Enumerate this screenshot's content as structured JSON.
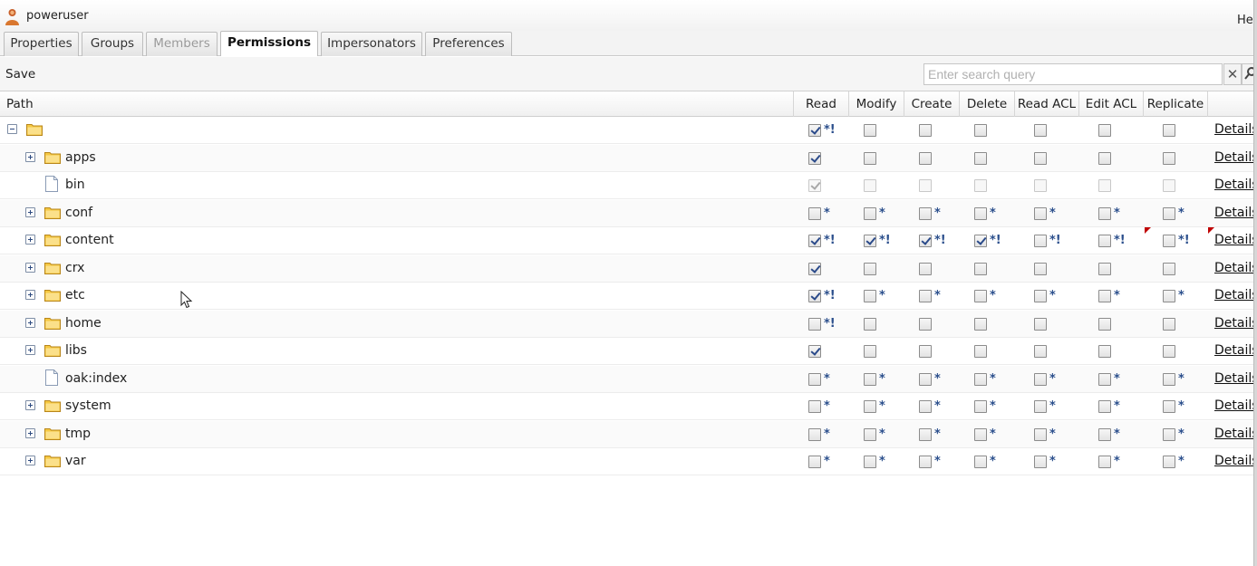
{
  "user": {
    "name": "poweruser",
    "icon": "user-icon"
  },
  "help_label": "Hel",
  "tabs": [
    {
      "label": "Properties",
      "state": "normal"
    },
    {
      "label": "Groups",
      "state": "normal"
    },
    {
      "label": "Members",
      "state": "disabled"
    },
    {
      "label": "Permissions",
      "state": "active"
    },
    {
      "label": "Impersonators",
      "state": "normal"
    },
    {
      "label": "Preferences",
      "state": "normal"
    }
  ],
  "toolbar": {
    "save_label": "Save"
  },
  "search": {
    "placeholder": "Enter search query",
    "clear_icon": "close-icon",
    "go_icon": "search-icon"
  },
  "columns": [
    "Path",
    "Read",
    "Modify",
    "Create",
    "Delete",
    "Read ACL",
    "Edit ACL",
    "Replicate"
  ],
  "details_label": "Details",
  "colors": {
    "check_mark": "#2a4a8a",
    "marker": "#2b4f8c",
    "corner_flag": "#c00000",
    "folder": "#f5c842"
  },
  "rows": [
    {
      "label": "",
      "type": "folder",
      "expander": "minus",
      "indent": 0,
      "cells": [
        {
          "checked": true,
          "mark": "*!"
        },
        {
          "checked": false,
          "mark": ""
        },
        {
          "checked": false,
          "mark": ""
        },
        {
          "checked": false,
          "mark": ""
        },
        {
          "checked": false,
          "mark": ""
        },
        {
          "checked": false,
          "mark": ""
        },
        {
          "checked": false,
          "mark": ""
        }
      ]
    },
    {
      "label": "apps",
      "type": "folder",
      "expander": "plus",
      "indent": 1,
      "cells": [
        {
          "checked": true,
          "mark": ""
        },
        {
          "checked": false,
          "mark": ""
        },
        {
          "checked": false,
          "mark": ""
        },
        {
          "checked": false,
          "mark": ""
        },
        {
          "checked": false,
          "mark": ""
        },
        {
          "checked": false,
          "mark": ""
        },
        {
          "checked": false,
          "mark": ""
        }
      ]
    },
    {
      "label": "bin",
      "type": "file",
      "expander": "none",
      "indent": 1,
      "dim": true,
      "cells": [
        {
          "checked": true,
          "mark": ""
        },
        {
          "checked": false,
          "mark": ""
        },
        {
          "checked": false,
          "mark": ""
        },
        {
          "checked": false,
          "mark": ""
        },
        {
          "checked": false,
          "mark": ""
        },
        {
          "checked": false,
          "mark": ""
        },
        {
          "checked": false,
          "mark": ""
        }
      ]
    },
    {
      "label": "conf",
      "type": "folder",
      "expander": "plus",
      "indent": 1,
      "cells": [
        {
          "checked": false,
          "mark": "*"
        },
        {
          "checked": false,
          "mark": "*"
        },
        {
          "checked": false,
          "mark": "*"
        },
        {
          "checked": false,
          "mark": "*"
        },
        {
          "checked": false,
          "mark": "*"
        },
        {
          "checked": false,
          "mark": "*"
        },
        {
          "checked": false,
          "mark": "*"
        }
      ]
    },
    {
      "label": "content",
      "type": "folder",
      "expander": "plus",
      "indent": 1,
      "flags": [
        5,
        6
      ],
      "cells": [
        {
          "checked": true,
          "mark": "*!"
        },
        {
          "checked": true,
          "mark": "*!"
        },
        {
          "checked": true,
          "mark": "*!"
        },
        {
          "checked": true,
          "mark": "*!"
        },
        {
          "checked": false,
          "mark": "*!"
        },
        {
          "checked": false,
          "mark": "*!"
        },
        {
          "checked": false,
          "mark": "*!"
        }
      ]
    },
    {
      "label": "crx",
      "type": "folder",
      "expander": "plus",
      "indent": 1,
      "cells": [
        {
          "checked": true,
          "mark": ""
        },
        {
          "checked": false,
          "mark": ""
        },
        {
          "checked": false,
          "mark": ""
        },
        {
          "checked": false,
          "mark": ""
        },
        {
          "checked": false,
          "mark": ""
        },
        {
          "checked": false,
          "mark": ""
        },
        {
          "checked": false,
          "mark": ""
        }
      ]
    },
    {
      "label": "etc",
      "type": "folder",
      "expander": "plus",
      "indent": 1,
      "cells": [
        {
          "checked": true,
          "mark": "*!"
        },
        {
          "checked": false,
          "mark": "*"
        },
        {
          "checked": false,
          "mark": "*"
        },
        {
          "checked": false,
          "mark": "*"
        },
        {
          "checked": false,
          "mark": "*"
        },
        {
          "checked": false,
          "mark": "*"
        },
        {
          "checked": false,
          "mark": "*"
        }
      ]
    },
    {
      "label": "home",
      "type": "folder",
      "expander": "plus",
      "indent": 1,
      "cells": [
        {
          "checked": false,
          "mark": "*!"
        },
        {
          "checked": false,
          "mark": ""
        },
        {
          "checked": false,
          "mark": ""
        },
        {
          "checked": false,
          "mark": ""
        },
        {
          "checked": false,
          "mark": ""
        },
        {
          "checked": false,
          "mark": ""
        },
        {
          "checked": false,
          "mark": ""
        }
      ]
    },
    {
      "label": "libs",
      "type": "folder",
      "expander": "plus",
      "indent": 1,
      "cells": [
        {
          "checked": true,
          "mark": ""
        },
        {
          "checked": false,
          "mark": ""
        },
        {
          "checked": false,
          "mark": ""
        },
        {
          "checked": false,
          "mark": ""
        },
        {
          "checked": false,
          "mark": ""
        },
        {
          "checked": false,
          "mark": ""
        },
        {
          "checked": false,
          "mark": ""
        }
      ]
    },
    {
      "label": "oak:index",
      "type": "file",
      "expander": "none",
      "indent": 1,
      "cells": [
        {
          "checked": false,
          "mark": "*"
        },
        {
          "checked": false,
          "mark": "*"
        },
        {
          "checked": false,
          "mark": "*"
        },
        {
          "checked": false,
          "mark": "*"
        },
        {
          "checked": false,
          "mark": "*"
        },
        {
          "checked": false,
          "mark": "*"
        },
        {
          "checked": false,
          "mark": "*"
        }
      ]
    },
    {
      "label": "system",
      "type": "folder",
      "expander": "plus",
      "indent": 1,
      "cells": [
        {
          "checked": false,
          "mark": "*"
        },
        {
          "checked": false,
          "mark": "*"
        },
        {
          "checked": false,
          "mark": "*"
        },
        {
          "checked": false,
          "mark": "*"
        },
        {
          "checked": false,
          "mark": "*"
        },
        {
          "checked": false,
          "mark": "*"
        },
        {
          "checked": false,
          "mark": "*"
        }
      ]
    },
    {
      "label": "tmp",
      "type": "folder",
      "expander": "plus",
      "indent": 1,
      "cells": [
        {
          "checked": false,
          "mark": "*"
        },
        {
          "checked": false,
          "mark": "*"
        },
        {
          "checked": false,
          "mark": "*"
        },
        {
          "checked": false,
          "mark": "*"
        },
        {
          "checked": false,
          "mark": "*"
        },
        {
          "checked": false,
          "mark": "*"
        },
        {
          "checked": false,
          "mark": "*"
        }
      ]
    },
    {
      "label": "var",
      "type": "folder",
      "expander": "plus",
      "indent": 1,
      "cells": [
        {
          "checked": false,
          "mark": "*"
        },
        {
          "checked": false,
          "mark": "*"
        },
        {
          "checked": false,
          "mark": "*"
        },
        {
          "checked": false,
          "mark": "*"
        },
        {
          "checked": false,
          "mark": "*"
        },
        {
          "checked": false,
          "mark": "*"
        },
        {
          "checked": false,
          "mark": "*"
        }
      ]
    }
  ]
}
